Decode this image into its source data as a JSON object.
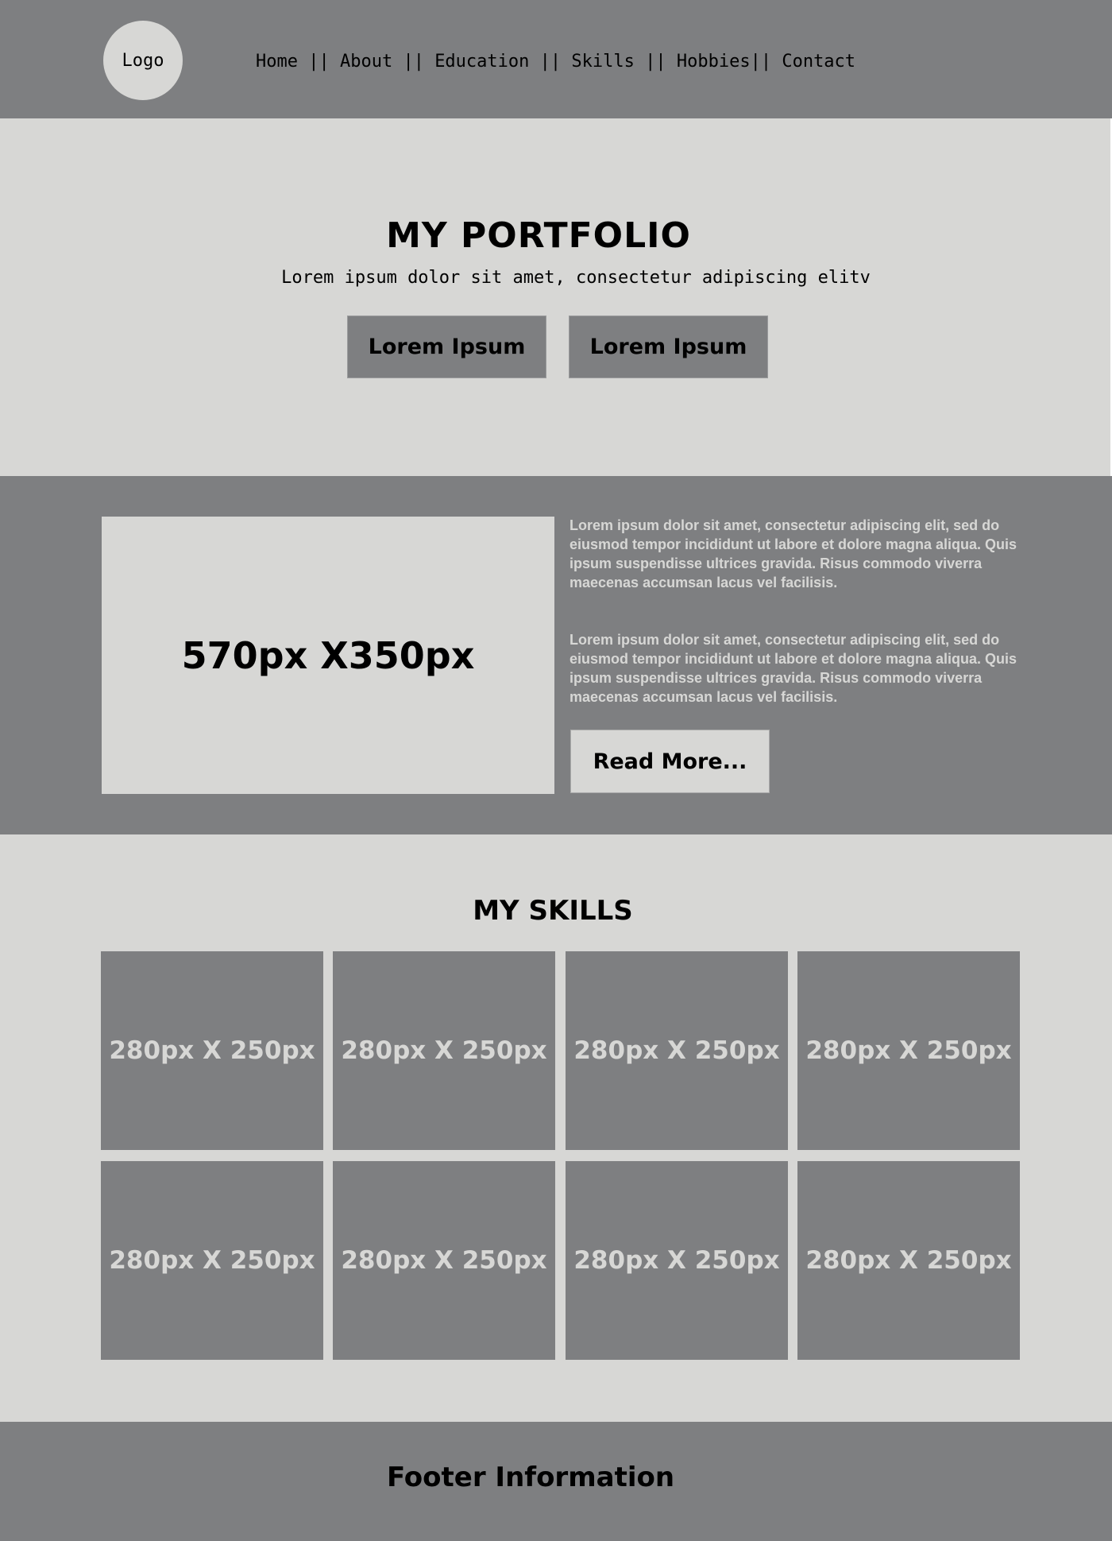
{
  "header": {
    "logo_text": "Logo",
    "nav": {
      "home": "Home",
      "about": "About",
      "education": "Education",
      "skills": "Skills",
      "hobbies": "Hobbies",
      "contact": "Contact",
      "sep": " || ",
      "sep_tight": "|| "
    }
  },
  "hero": {
    "title": "MY PORTFOLIO",
    "subtitle": "Lorem ipsum dolor sit amet, consectetur adipiscing elitv",
    "button1": "Lorem Ipsum",
    "button2": "Lorem Ipsum"
  },
  "about": {
    "image_placeholder": "570px X350px",
    "paragraph1": "Lorem ipsum dolor sit amet, consectetur adipiscing elit, sed do eiusmod tempor incididunt ut labore et dolore magna aliqua. Quis ipsum suspendisse ultrices gravida. Risus commodo viverra maecenas accumsan lacus vel facilisis.",
    "paragraph2": "Lorem ipsum dolor sit amet, consectetur adipiscing elit, sed do eiusmod tempor incididunt ut labore et dolore magna aliqua. Quis ipsum suspendisse ultrices gravida. Risus commodo viverra maecenas accumsan lacus vel facilisis.",
    "read_more": "Read More..."
  },
  "skills": {
    "title": "MY SKILLS",
    "cards": [
      "280px X 250px",
      "280px X 250px",
      "280px X 250px",
      "280px X 250px",
      "280px X 250px",
      "280px X 250px",
      "280px X 250px",
      "280px X 250px"
    ]
  },
  "footer": {
    "text": "Footer Information"
  },
  "colors": {
    "dark_gray": "#7e7f81",
    "light_gray": "#d7d7d5"
  }
}
